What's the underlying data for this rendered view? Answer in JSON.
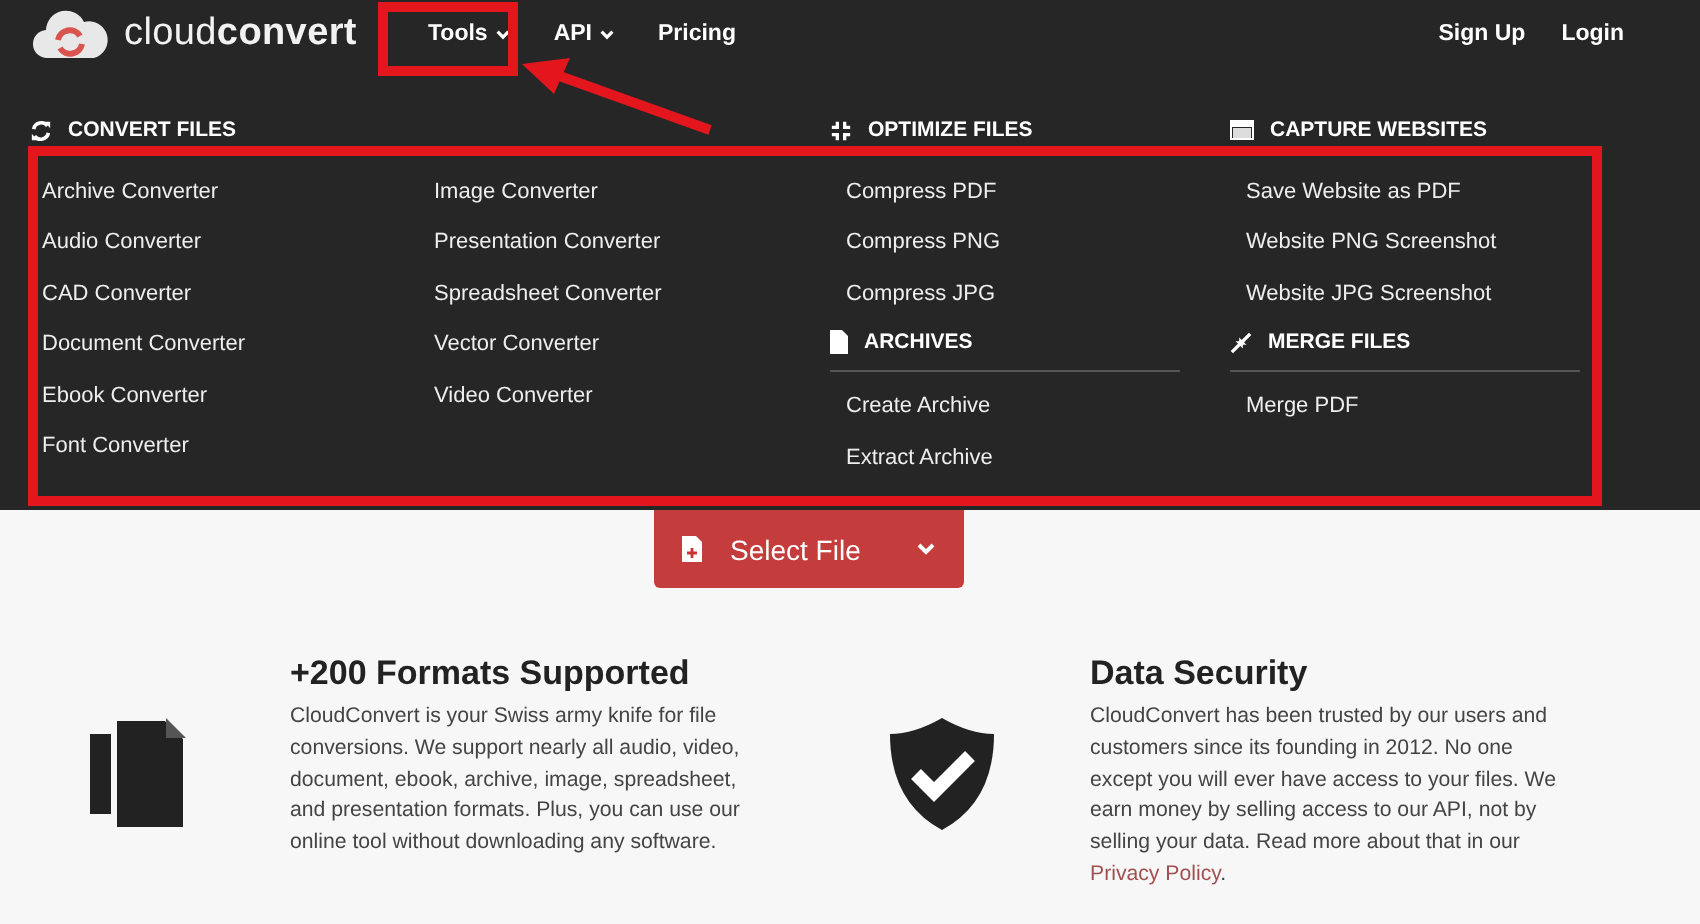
{
  "header": {
    "logo": "cloud**convert**",
    "nav": [
      {
        "label": "Tools",
        "caret": true
      },
      {
        "label": "API",
        "caret": true
      },
      {
        "label": "Pricing",
        "caret": false
      }
    ],
    "account": [
      "Sign Up",
      "Login"
    ]
  },
  "menu": {
    "convert": {
      "title": "CONVERT FILES",
      "items": [
        "Archive Converter",
        "Audio Converter",
        "CAD Converter",
        "Document Converter",
        "Ebook Converter",
        "Font Converter",
        "Image Converter",
        "Presentation Converter",
        "Spreadsheet Converter",
        "Vector Converter",
        "Video Converter"
      ]
    },
    "columns": [
      [
        {
          "kind": "compress",
          "title": "OPTIMIZE FILES",
          "items": [
            "Compress PDF",
            "Compress PNG",
            "Compress JPG"
          ]
        },
        {
          "kind": "file",
          "title": "ARCHIVES",
          "items": [
            "Create Archive",
            "Extract Archive"
          ]
        }
      ],
      [
        {
          "kind": "window",
          "title": "CAPTURE WEBSITES",
          "items": [
            "Save Website as PDF",
            "Website PNG Screenshot",
            "Website JPG Screenshot"
          ]
        },
        {
          "kind": "merge",
          "title": "MERGE FILES",
          "items": [
            "Merge PDF"
          ]
        }
      ]
    ]
  },
  "select_button": {
    "label": "Select File"
  },
  "features": [
    {
      "kind": "files",
      "title": "+200 Formats Supported",
      "text": "CloudConvert is your Swiss army knife for file conversions. We support nearly all audio, video, document, ebook, archive, image, spreadsheet, and presentation formats. Plus, you can use our online tool without downloading any software."
    },
    {
      "kind": "shield",
      "title": "Data Security",
      "text": "CloudConvert has been trusted by our users and customers since its founding in 2012. No one except you will ever have access to your files. We earn money by selling access to our API, not by selling your data. Read more about that in our",
      "link": "Privacy Policy",
      "after": "."
    }
  ]
}
